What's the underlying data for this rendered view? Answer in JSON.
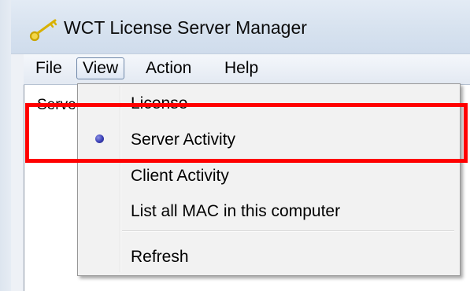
{
  "window": {
    "title": "WCT License Server Manager",
    "icon": "key-icon"
  },
  "menubar": {
    "file": "File",
    "view": "View",
    "action": "Action",
    "help": "Help"
  },
  "content": {
    "header_partial": "Serve"
  },
  "view_menu": {
    "items": [
      {
        "label": "License",
        "checked": false
      },
      {
        "label": "Server Activity",
        "checked": true
      },
      {
        "label": "Client Activity",
        "checked": false
      },
      {
        "label": "List all MAC in this computer",
        "checked": false
      },
      {
        "label": "Refresh",
        "checked": false
      }
    ]
  },
  "annotation": {
    "highlight_color": "#ff0000"
  }
}
